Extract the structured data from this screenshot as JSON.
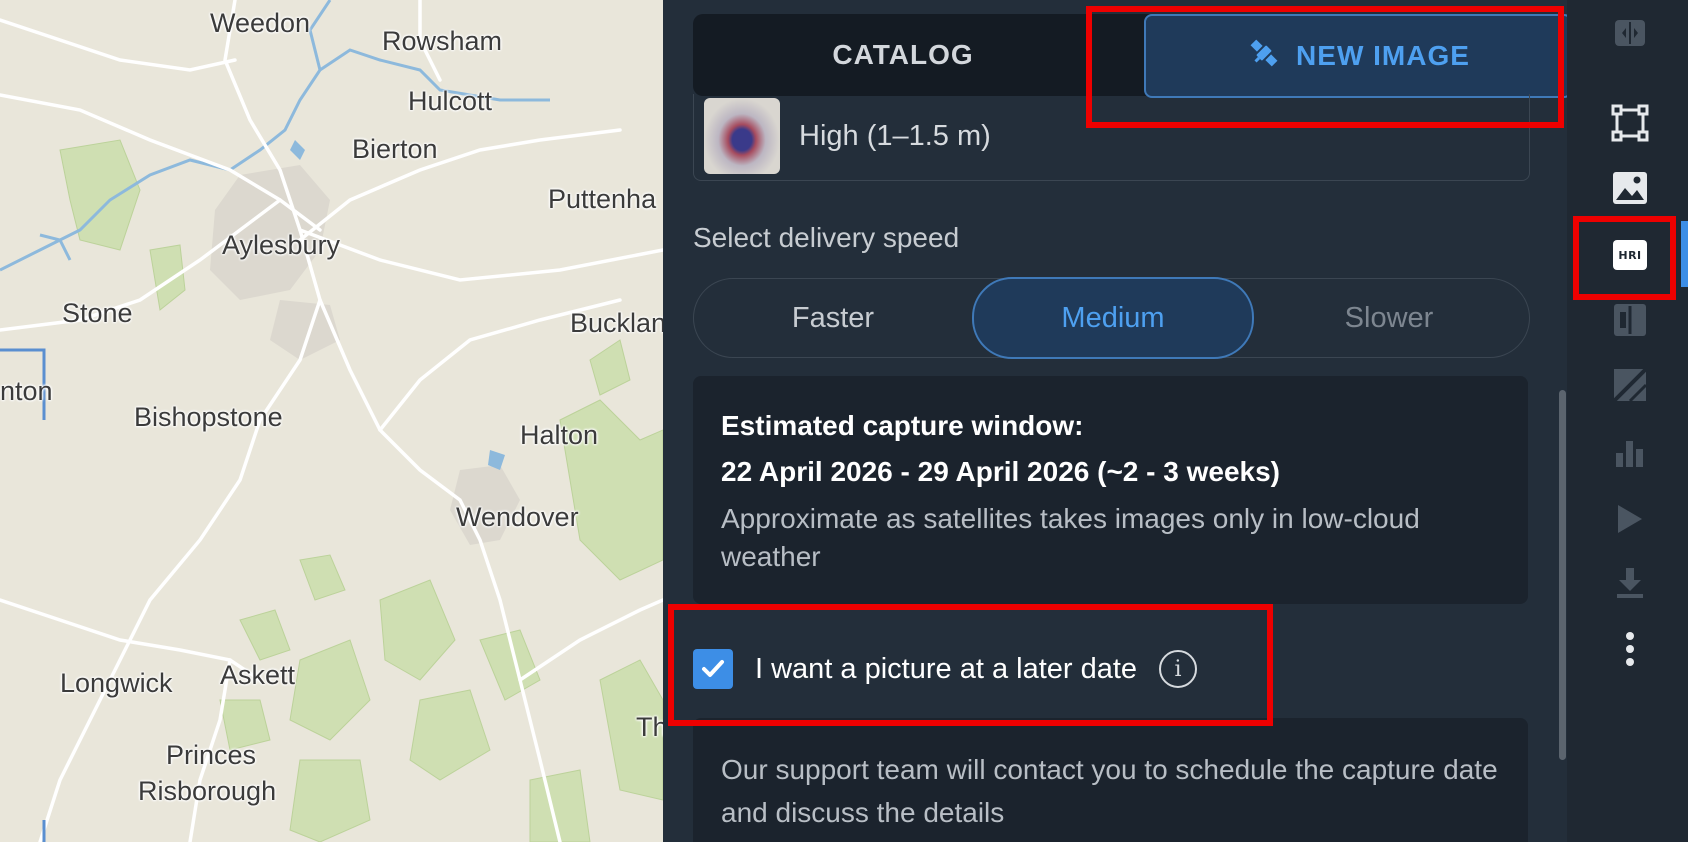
{
  "map": {
    "labels": {
      "weedon": "Weedon",
      "rowsham": "Rowsham",
      "hulcott": "Hulcott",
      "bierton": "Bierton",
      "puttenham": "Puttenha",
      "aylesbury": "Aylesbury",
      "stone": "Stone",
      "bucklan": "Bucklan",
      "nton": "nton",
      "bishopstone": "Bishopstone",
      "halton": "Halton",
      "wendover": "Wendover",
      "longwick": "Longwick",
      "askett": "Askett",
      "princes": "Princes",
      "risborough": "Risborough",
      "th": "Th"
    }
  },
  "tabs": {
    "catalog": "CATALOG",
    "new_image": "NEW IMAGE",
    "new_image_icon": "satellite-icon"
  },
  "resolution": {
    "label": "High (1–1.5 m)"
  },
  "delivery": {
    "title": "Select delivery speed",
    "options": [
      "Faster",
      "Medium",
      "Slower"
    ],
    "selected": "Medium"
  },
  "estimate": {
    "title": "Estimated capture window:",
    "dates": "22 April 2026 - 29 April 2026 (~2 - 3 weeks)",
    "note": "Approximate as satellites takes images only in low-cloud weather"
  },
  "later_date": {
    "label": "I want a picture at a later date",
    "checked": true,
    "info_icon": "info-icon"
  },
  "support": {
    "text": "Our support team will contact you to schedule the capture date and discuss the details"
  },
  "toolbar": {
    "hri_label": "HRI",
    "icons": [
      "split-view-icon",
      "aoi-select-icon",
      "image-icon",
      "hri-icon",
      "compare-icon",
      "layers-icon",
      "chart-icon",
      "play-icon",
      "download-icon",
      "more-icon"
    ]
  },
  "colors": {
    "accent": "#3d8ee6",
    "panel_bg": "#232e3a",
    "annotation": "#ee0000"
  }
}
